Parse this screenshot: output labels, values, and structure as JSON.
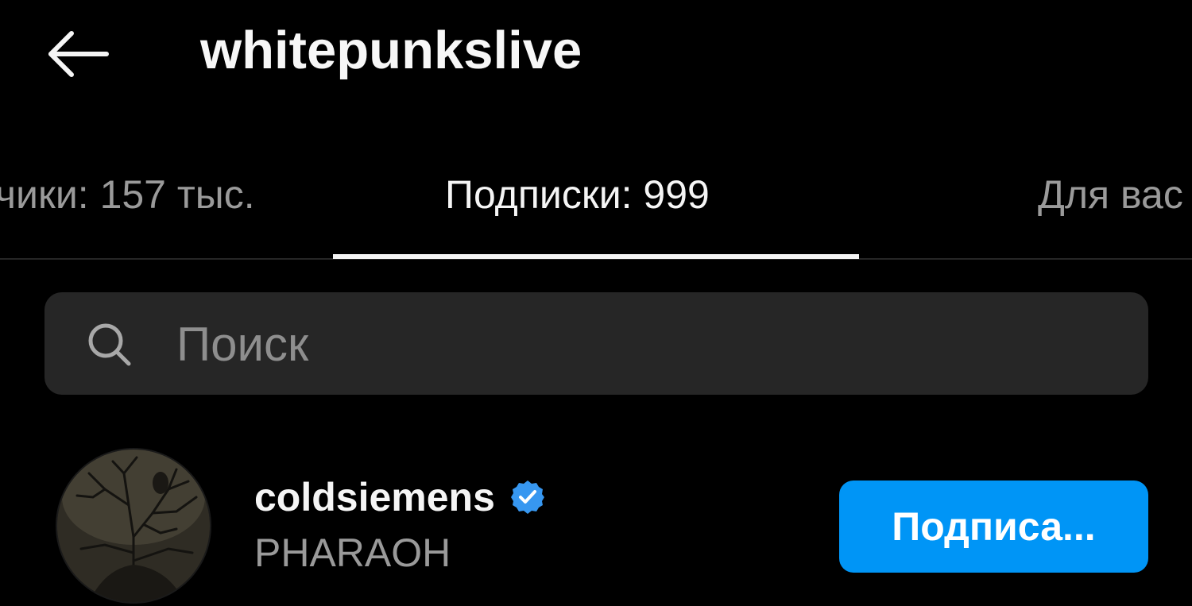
{
  "header": {
    "title": "whitepunkslive",
    "back_icon": "arrow-left-icon"
  },
  "tabs": [
    {
      "label": "чики: 157 тыс.",
      "active": false
    },
    {
      "label": "Подписки: 999",
      "active": true
    },
    {
      "label": "Для вас",
      "active": false
    }
  ],
  "search": {
    "placeholder": "Поиск",
    "value": "",
    "icon": "search-icon"
  },
  "users": [
    {
      "username": "coldsiemens",
      "verified": true,
      "full_name": "PHARAOH",
      "button_label": "Подписа..."
    }
  ],
  "colors": {
    "background": "#000000",
    "accent": "#0095f6",
    "search_bg": "#262626",
    "secondary_text": "#9a9a9a",
    "primary_text": "#f5f5f5"
  }
}
